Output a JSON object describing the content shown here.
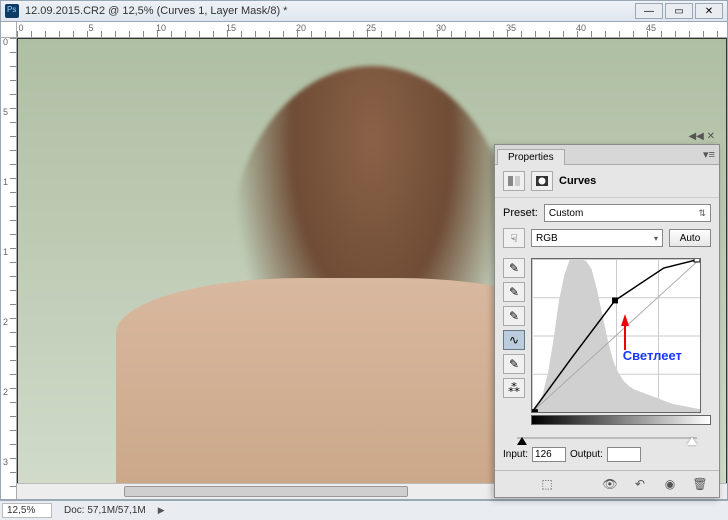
{
  "window": {
    "title": "12.09.2015.CR2 @ 12,5% (Curves 1, Layer Mask/8) *"
  },
  "ruler": {
    "h": [
      "0",
      "5",
      "10",
      "15",
      "20",
      "25",
      "30",
      "35",
      "40",
      "45"
    ],
    "v": [
      "0",
      "5",
      "1",
      "1",
      "2",
      "2",
      "3"
    ]
  },
  "status": {
    "zoom": "12,5%",
    "doc_label": "Doc:",
    "doc_value": "57,1M/57,1M"
  },
  "panel": {
    "tab": "Properties",
    "title": "Curves",
    "preset_label": "Preset:",
    "preset_value": "Custom",
    "channel_value": "RGB",
    "auto_label": "Auto",
    "input_label": "Input:",
    "input_value": "126",
    "output_label": "Output:",
    "output_value": "",
    "annotation": "Светлеет"
  },
  "chart_data": {
    "type": "line",
    "title": "Curves",
    "xlabel": "Input",
    "ylabel": "Output",
    "xlim": [
      0,
      255
    ],
    "ylim": [
      0,
      255
    ],
    "series": [
      {
        "name": "baseline",
        "x": [
          0,
          255
        ],
        "y": [
          0,
          255
        ]
      },
      {
        "name": "curve",
        "x": [
          0,
          60,
          126,
          200,
          255
        ],
        "y": [
          0,
          90,
          186,
          240,
          255
        ]
      }
    ],
    "control_point": {
      "x": 126,
      "y": 186
    },
    "histogram": [
      2,
      6,
      18,
      40,
      72,
      110,
      135,
      150,
      150,
      150,
      148,
      140,
      120,
      95,
      70,
      50,
      38,
      30,
      25,
      22,
      20,
      18,
      16,
      14,
      12,
      10,
      8,
      7,
      6,
      5,
      4,
      3
    ]
  }
}
